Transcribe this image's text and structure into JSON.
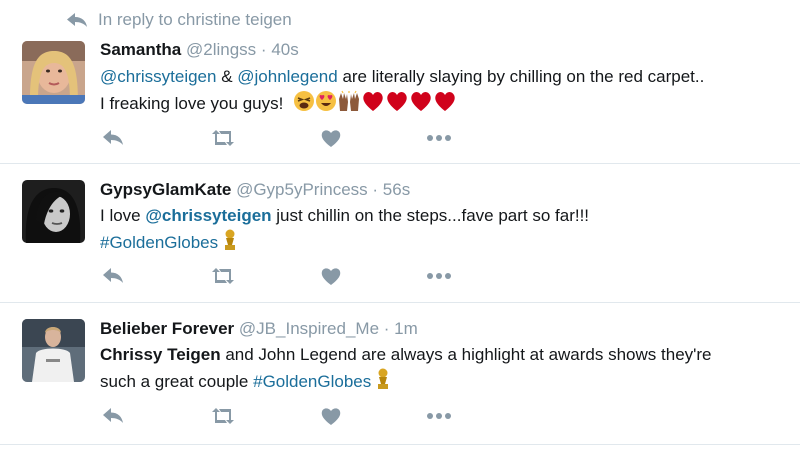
{
  "reply_context": {
    "text": "In reply to christine teigen",
    "icon": "reply-icon"
  },
  "tweets": [
    {
      "name": "Samantha",
      "handle": "@2lingss",
      "sep": "·",
      "time": "40s",
      "avatar": "avatar-blonde-woman",
      "line1": {
        "mention1": "@chrissyteigen",
        "amp": " & ",
        "mention2": "@johnlegend",
        "rest": " are literally slaying by chilling on the red carpet.."
      },
      "line2": {
        "text": "I freaking love you guys! "
      },
      "emoji_names": [
        "tired-face-emoji",
        "heart-eyes-emoji",
        "raised-hands-emoji",
        "red-heart-emoji",
        "red-heart-emoji",
        "red-heart-emoji",
        "red-heart-emoji"
      ]
    },
    {
      "name": "GypsyGlamKate",
      "handle": "@Gyp5yPrincess",
      "sep": "·",
      "time": "56s",
      "avatar": "avatar-dark-hair-woman",
      "line1": {
        "pre": "I love ",
        "mention": "@chrissyteigen",
        "rest": " just chillin on the steps...fave part so far!!!"
      },
      "line2": {
        "hashtag": "#GoldenGlobes"
      },
      "emoji_names": [
        "golden-globe-trophy-icon"
      ]
    },
    {
      "name": "Belieber Forever",
      "handle": "@JB_Inspired_Me",
      "sep": "·",
      "time": "1m",
      "avatar": "avatar-performer",
      "line1": {
        "bold": "Chrissy Teigen",
        "rest": " and John Legend are always a highlight at awards shows they're"
      },
      "line2": {
        "pre": "such a great couple ",
        "hashtag": "#GoldenGlobes"
      },
      "emoji_names": [
        "golden-globe-trophy-icon"
      ]
    }
  ],
  "actions": [
    "reply-icon",
    "retweet-icon",
    "like-icon",
    "more-icon"
  ],
  "colors": {
    "link": "#1b6e9a",
    "muted": "#8899a6",
    "divider": "#e1e8ed",
    "heart": "#d0021b"
  }
}
